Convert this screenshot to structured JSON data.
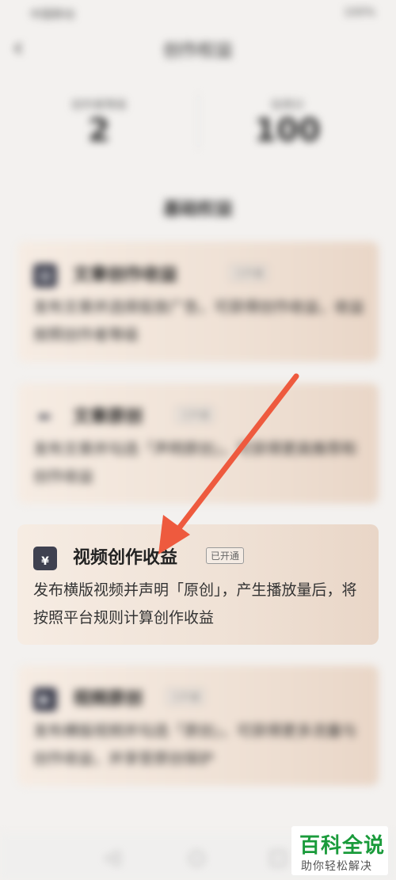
{
  "status_bar": {
    "left": "中国移动",
    "right": "100%"
  },
  "nav": {
    "title": "创作权益"
  },
  "stats": [
    {
      "label": "创作者等级",
      "value": "2"
    },
    {
      "label": "信用分",
      "value": "100"
    }
  ],
  "section_title": "基础权益",
  "cards": [
    {
      "icon": "document-icon",
      "title": "文章创作收益",
      "badge": "已开通",
      "desc": "发布文章并选择投放广告，可获得创作收益，收益按照创作者等级"
    },
    {
      "icon": "feather-icon",
      "title": "文章原创",
      "badge": "已开通",
      "desc": "发布文章并勾选「声明原创」，可获得更高推荐和创作收益"
    },
    {
      "icon": "tv-yen-icon",
      "title": "视频创作收益",
      "badge": "已开通",
      "desc": "发布横版视频并声明「原创」，产生播放量后，将按照平台规则计算创作收益"
    },
    {
      "icon": "video-icon",
      "title": "视频原创",
      "badge": "已开通",
      "desc": "发布横版视频并勾选「原创」，可获得更多流量与创作收益，并享受原创保护"
    }
  ],
  "bottom_nav": {
    "back": "◁",
    "home": "○",
    "recent": "□"
  },
  "watermark": {
    "main": "百科全说",
    "sub": "助你轻松解决"
  },
  "colors": {
    "arrow": "#ee5a3e",
    "watermark_green": "#1a9b3b",
    "card_icon": "#3f4150"
  }
}
